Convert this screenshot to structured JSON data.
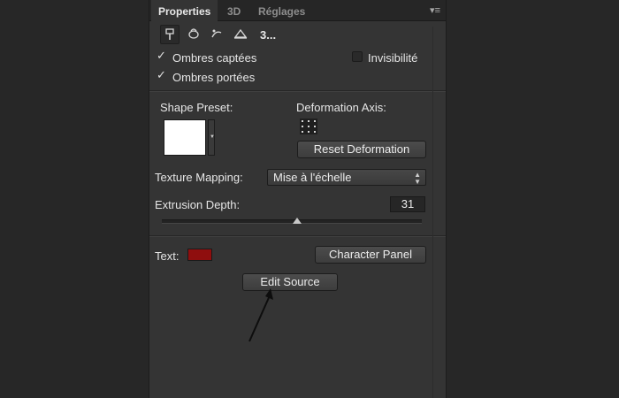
{
  "tabs": [
    {
      "label": "Properties",
      "active": true
    },
    {
      "label": "3D",
      "active": false
    },
    {
      "label": "Réglages",
      "active": false
    }
  ],
  "tab_menu_glyph": "▾≡",
  "icons": [
    "mesh-icon",
    "deformation-icon",
    "cap-icon",
    "coordinates-icon"
  ],
  "icons_more_label": "3...",
  "options": {
    "captured_shadows": {
      "label": "Ombres captées",
      "checked": true
    },
    "cast_shadows": {
      "label": "Ombres portées",
      "checked": true
    },
    "invisibility": {
      "label": "Invisibilité",
      "checked": false
    }
  },
  "shape_preset": {
    "label": "Shape Preset:"
  },
  "deformation_axis": {
    "label": "Deformation Axis:"
  },
  "reset_deformation_label": "Reset Deformation",
  "texture_mapping": {
    "label": "Texture Mapping:",
    "value": "Mise à l'échelle"
  },
  "extrusion_depth": {
    "label": "Extrusion Depth:",
    "value": "31",
    "slider_fraction": 0.52
  },
  "text": {
    "label": "Text:",
    "color": "#8f0e0e"
  },
  "character_panel_label": "Character Panel",
  "edit_source_label": "Edit Source",
  "colors": {
    "panel_bg": "#343434",
    "tab_bg": "#262626",
    "text_swatch": "#8f0e0e"
  }
}
